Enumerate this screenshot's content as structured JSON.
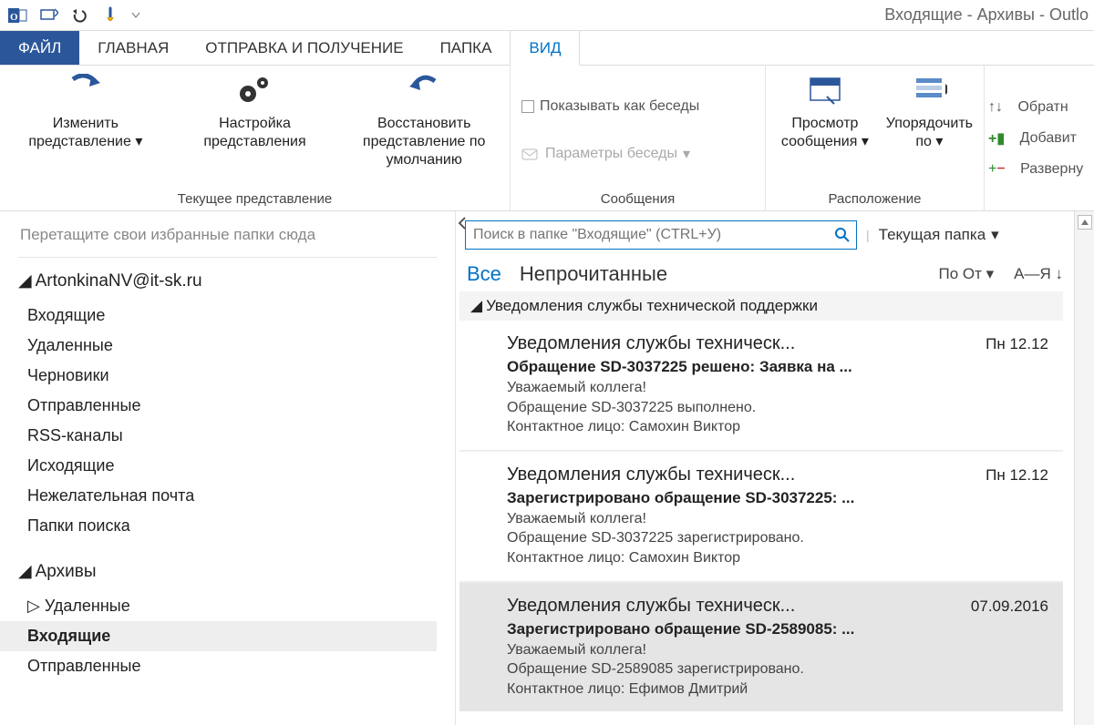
{
  "window": {
    "title": "Входящие - Архивы - Outlo"
  },
  "tabs": {
    "file": "ФАЙЛ",
    "home": "ГЛАВНАЯ",
    "sendreceive": "ОТПРАВКА И ПОЛУЧЕНИЕ",
    "folder": "ПАПКА",
    "view": "ВИД"
  },
  "ribbon": {
    "group_view": {
      "change_view": "Изменить представление",
      "view_settings": "Настройка представления",
      "reset_view": "Восстановить представление по умолчанию",
      "label": "Текущее представление"
    },
    "group_msgs": {
      "show_convo": "Показывать как беседы",
      "convo_settings": "Параметры беседы",
      "label": "Сообщения"
    },
    "group_arrange": {
      "preview": "Просмотр сообщения",
      "arrange_by": "Упорядочить по",
      "label": "Расположение"
    },
    "right": {
      "reverse": "Обратн",
      "add": "Добавит",
      "expand": "Разверну"
    }
  },
  "nav": {
    "hint": "Перетащите свои избранные папки сюда",
    "account": "ArtonkinaNV@it-sk.ru",
    "folders1": [
      "Входящие",
      "Удаленные",
      "Черновики",
      "Отправленные",
      "RSS-каналы",
      "Исходящие",
      "Нежелательная почта",
      "Папки поиска"
    ],
    "archives": "Архивы",
    "folders2": [
      {
        "label": "Удаленные",
        "bold": false,
        "expander": "▷"
      },
      {
        "label": "Входящие",
        "bold": true,
        "expander": ""
      },
      {
        "label": "Отправленные",
        "bold": false,
        "expander": ""
      }
    ]
  },
  "search": {
    "placeholder": "Поиск в папке \"Входящие\" (CTRL+У)",
    "scope": "Текущая папка"
  },
  "filter": {
    "all": "Все",
    "unread": "Непрочитанные",
    "sort1": "По От",
    "sort2": "А—Я"
  },
  "group_header": "Уведомления службы технической поддержки",
  "messages": [
    {
      "from": "Уведомления службы техническ...",
      "subject": "Обращение SD-3037225 решено: Заявка на ...",
      "date": "Пн 12.12",
      "preview": "Уважаемый коллега!\nОбращение SD-3037225 выполнено.\nКонтактное лицо: Самохин Виктор",
      "selected": false
    },
    {
      "from": "Уведомления службы техническ...",
      "subject": "Зарегистрировано обращение SD-3037225: ...",
      "date": "Пн 12.12",
      "preview": "Уважаемый коллега!\nОбращение SD-3037225 зарегистрировано.\nКонтактное лицо: Самохин Виктор",
      "selected": false
    },
    {
      "from": "Уведомления службы техническ...",
      "subject": "Зарегистрировано обращение SD-2589085: ...",
      "date": "07.09.2016",
      "preview": "Уважаемый коллега!\nОбращение SD-2589085 зарегистрировано.\nКонтактное лицо: Ефимов Дмитрий",
      "selected": true
    }
  ]
}
